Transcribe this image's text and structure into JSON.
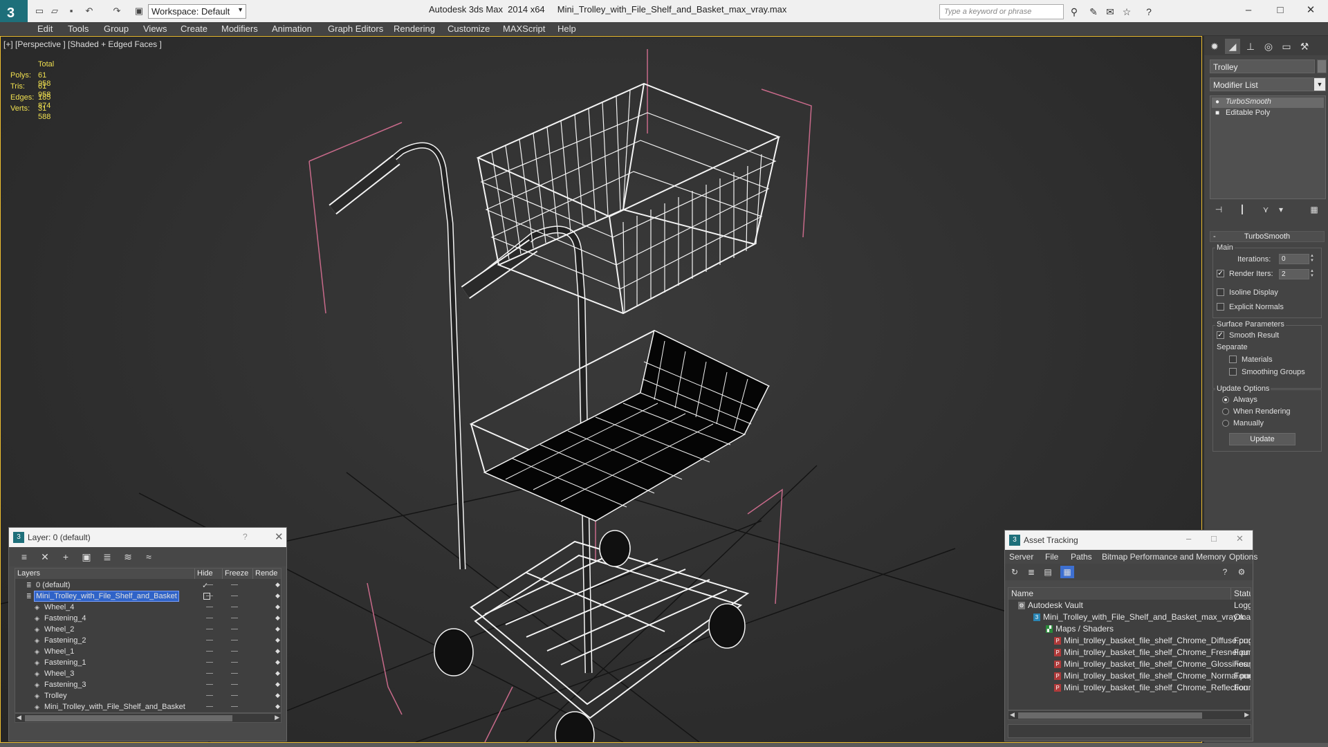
{
  "title": {
    "app": "Autodesk 3ds Max  2014 x64",
    "file": "Mini_Trolley_with_File_Shelf_and_Basket_max_vray.max",
    "workspace": "Workspace: Default",
    "search_placeholder": "Type a keyword or phrase"
  },
  "menu": [
    "Edit",
    "Tools",
    "Group",
    "Views",
    "Create",
    "Modifiers",
    "Animation",
    "Graph Editors",
    "Rendering",
    "Customize",
    "MAXScript",
    "Help"
  ],
  "viewport": {
    "label": "[+] [Perspective ] [Shaded + Edged Faces ]",
    "stats_header": "Total",
    "stats": [
      {
        "k": "Polys:",
        "v": "61 958"
      },
      {
        "k": "Tris:",
        "v": "61 958"
      },
      {
        "k": "Edges:",
        "v": "185 874"
      },
      {
        "k": "Verts:",
        "v": "31 588"
      }
    ]
  },
  "command_panel": {
    "object_name": "Trolley",
    "modifier_list": "Modifier List",
    "stack": [
      "TurboSmooth",
      "Editable Poly"
    ],
    "rollout_title": "TurboSmooth",
    "main_group": "Main",
    "iterations_label": "Iterations:",
    "iterations_value": "0",
    "render_iters_label": "Render Iters:",
    "render_iters_value": "2",
    "isoline": "Isoline Display",
    "explicit_normals": "Explicit Normals",
    "surface_params": "Surface Parameters",
    "smooth_result": "Smooth Result",
    "separate": "Separate",
    "materials": "Materials",
    "smoothing_groups": "Smoothing Groups",
    "update_options": "Update Options",
    "always": "Always",
    "when_rendering": "When Rendering",
    "manually": "Manually",
    "update_button": "Update"
  },
  "layers": {
    "title": "Layer: 0 (default)",
    "help": "?",
    "columns": [
      "Layers",
      "Hide",
      "Freeze",
      "Rende"
    ],
    "rows": [
      {
        "name": "0 (default)",
        "indent": 1
      },
      {
        "name": "Mini_Trolley_with_File_Shelf_and_Basket",
        "indent": 1
      },
      {
        "name": "Wheel_4",
        "indent": 2
      },
      {
        "name": "Fastening_4",
        "indent": 2
      },
      {
        "name": "Wheel_2",
        "indent": 2
      },
      {
        "name": "Fastening_2",
        "indent": 2
      },
      {
        "name": "Wheel_1",
        "indent": 2
      },
      {
        "name": "Fastening_1",
        "indent": 2
      },
      {
        "name": "Wheel_3",
        "indent": 2
      },
      {
        "name": "Fastening_3",
        "indent": 2
      },
      {
        "name": "Trolley",
        "indent": 2
      },
      {
        "name": "Mini_Trolley_with_File_Shelf_and_Basket",
        "indent": 2
      }
    ]
  },
  "assets": {
    "title": "Asset Tracking",
    "menu": [
      "Server",
      "File",
      "Paths",
      "Bitmap Performance and Memory",
      "Options"
    ],
    "columns": [
      "Name",
      "Status"
    ],
    "rows": [
      {
        "name": "Autodesk Vault",
        "status": "Logged O"
      },
      {
        "name": "Mini_Trolley_with_File_Shelf_and_Basket_max_vray.max",
        "status": "Ok"
      },
      {
        "name": "Maps / Shaders",
        "status": ""
      },
      {
        "name": "Mini_trolley_basket_file_shelf_Chrome_Diffuse.png",
        "status": "Found"
      },
      {
        "name": "Mini_trolley_basket_file_shelf_Chrome_Fresnel.png",
        "status": "Found"
      },
      {
        "name": "Mini_trolley_basket_file_shelf_Chrome_Glossines.png",
        "status": "Found"
      },
      {
        "name": "Mini_trolley_basket_file_shelf_Chrome_Normal.png",
        "status": "Found"
      },
      {
        "name": "Mini_trolley_basket_file_shelf_Chrome_Reflection.png",
        "status": "Found"
      }
    ]
  }
}
